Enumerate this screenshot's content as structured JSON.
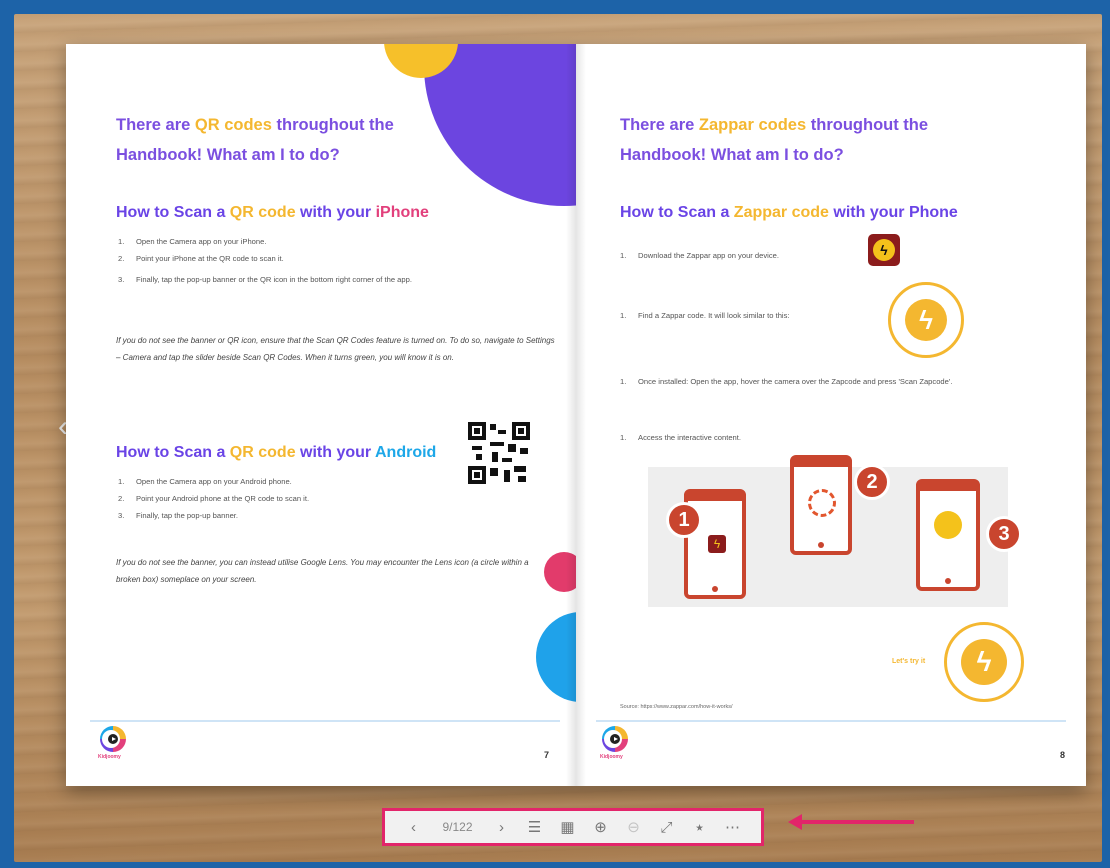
{
  "left_page": {
    "title_prefix": "There are ",
    "title_highlight": "QR codes",
    "title_suffix": " throughout the",
    "title_line2": "Handbook! What am I to do?",
    "iphone_heading": {
      "prefix": "How to Scan a ",
      "highlight": "QR code",
      "middle": " with your ",
      "device": "iPhone"
    },
    "iphone_steps": [
      {
        "num": "1.",
        "text": "Open the Camera app on your iPhone."
      },
      {
        "num": "2.",
        "text": "Point your iPhone at the QR code to scan it."
      },
      {
        "num": "3.",
        "text": "Finally, tap the pop-up banner or the QR icon in the bottom right corner of the app."
      }
    ],
    "iphone_note": "If you do not see the banner or QR icon, ensure that the Scan QR Codes feature is turned on. To do so, navigate to Settings – Camera and tap the slider beside Scan QR Codes. When it turns green, you will know it is on.",
    "android_heading": {
      "prefix": "How to Scan a ",
      "highlight": "QR code",
      "middle": " with your ",
      "device": "Android"
    },
    "android_steps": [
      {
        "num": "1.",
        "text": "Open the Camera app on your Android phone."
      },
      {
        "num": "2.",
        "text": "Point your Android phone at the QR code to scan it."
      },
      {
        "num": "3.",
        "text": "Finally, tap the pop-up banner."
      }
    ],
    "android_note": "If you do not see the banner, you can instead utilise Google Lens. You may encounter the Lens icon (a circle within a broken box) someplace on your screen.",
    "logo_text": "Kidjoomy",
    "page_number": "7"
  },
  "right_page": {
    "title_prefix": "There are ",
    "title_highlight": "Zappar codes",
    "title_suffix": " throughout the",
    "title_line2": "Handbook! What am I to do?",
    "heading": {
      "prefix": "How to Scan a ",
      "highlight": "Zappar code",
      "suffix": " with your Phone"
    },
    "steps": [
      {
        "num": "1.",
        "text": "Download the Zappar app on your device."
      },
      {
        "num": "1.",
        "text": "Find a Zappar code. It will look similar to this:"
      },
      {
        "num": "1.",
        "text": "Once installed: Open the app, hover the camera over the Zapcode and press 'Scan Zapcode'."
      },
      {
        "num": "1.",
        "text": "Access the interactive content."
      }
    ],
    "badges": [
      "1",
      "2",
      "3"
    ],
    "lets_try": "Let's try it",
    "source": "Source: https://www.zappar.com/how-it-works/",
    "logo_text": "Kidjoomy",
    "page_number": "8"
  },
  "toolbar": {
    "prev_icon": "‹",
    "page_indicator": "9/122",
    "next_icon": "›",
    "toc_icon": "☰",
    "thumbnails_icon": "▦",
    "zoom_in_icon": "⊕",
    "zoom_out_icon": "⊖",
    "fullscreen_icon": "⤢",
    "share_icon": "⭑",
    "more_icon": "⋯"
  },
  "nav": {
    "prev_page_icon": "‹",
    "next_page_icon": "›"
  },
  "colors": {
    "purple": "#6c45e0",
    "orange": "#f4b730",
    "pink": "#e2407c",
    "blue": "#1da7e8",
    "highlight_box": "#e2256a"
  }
}
